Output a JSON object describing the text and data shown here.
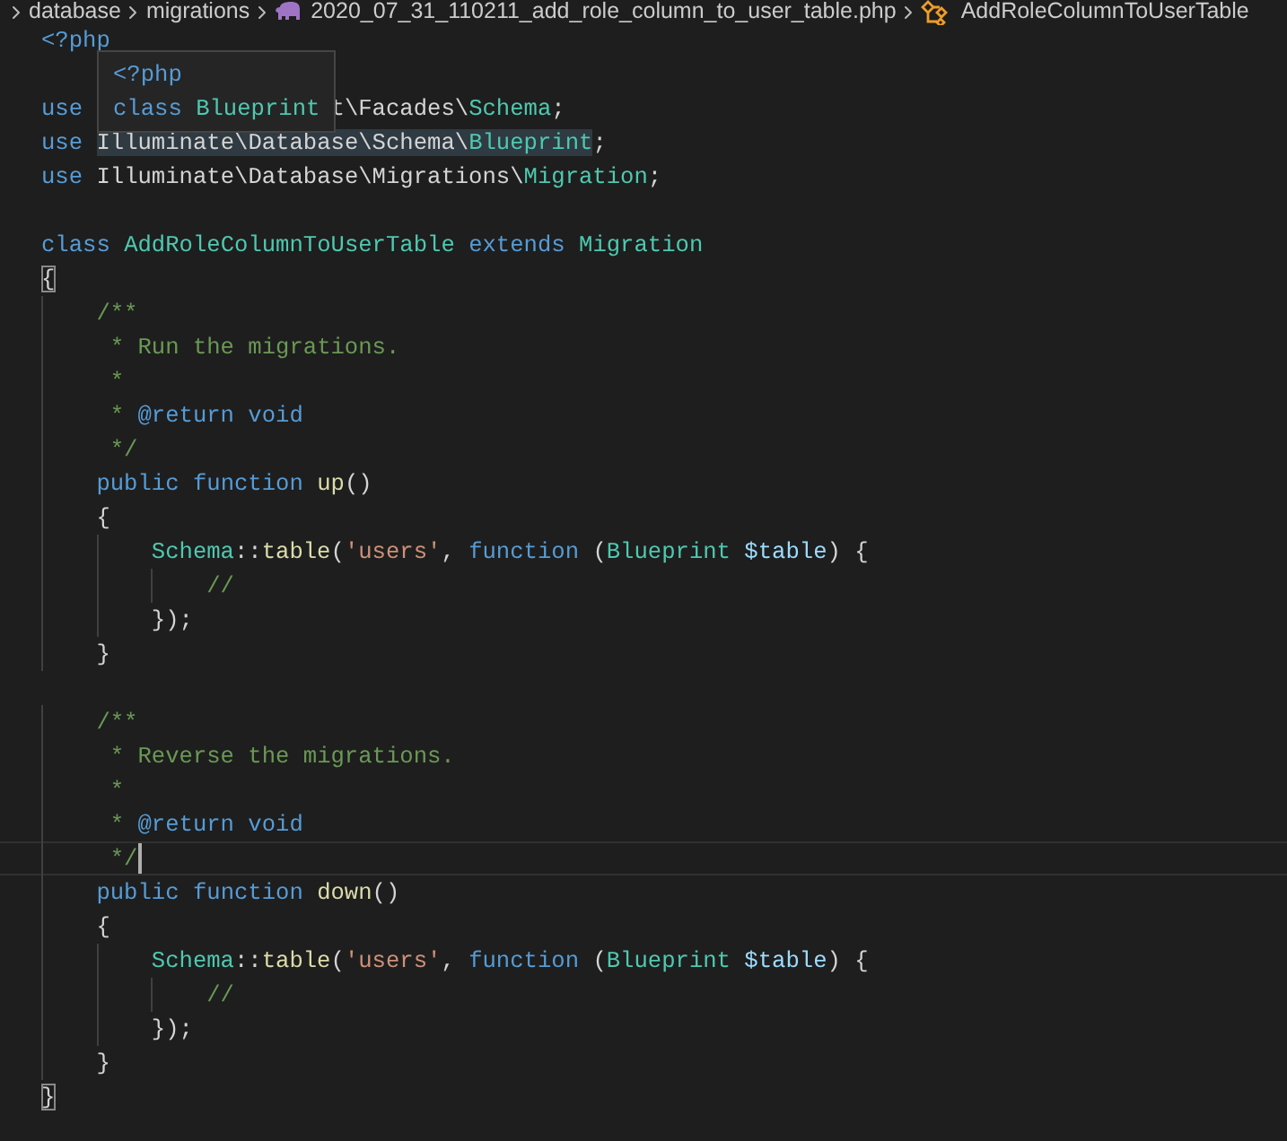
{
  "breadcrumb": [
    {
      "text": "database",
      "kind": "folder"
    },
    {
      "text": "migrations",
      "kind": "folder"
    },
    {
      "text": "2020_07_31_110211_add_role_column_to_user_table.php",
      "kind": "file"
    },
    {
      "text": "AddRoleColumnToUserTable",
      "kind": "symbol"
    }
  ],
  "tooltip": {
    "lines": [
      [
        {
          "text": "<?php",
          "kind": "keyword"
        }
      ],
      [
        {
          "text": "class ",
          "kind": "keyword"
        },
        {
          "text": "Blueprint",
          "kind": "type"
        }
      ]
    ]
  },
  "lines": [
    {
      "tokens": [
        {
          "text": "<?php",
          "kind": "keyword"
        }
      ]
    },
    {
      "kind": "blank"
    },
    {
      "tokens": [
        {
          "text": "use ",
          "kind": "keyword"
        }
      ],
      "after_tooltip": [
        {
          "text": "t\\Facades\\",
          "kind": "plain"
        },
        {
          "text": "Schema",
          "kind": "type"
        },
        {
          "text": ";",
          "kind": "plain"
        }
      ]
    },
    {
      "tokens": [
        {
          "text": "use ",
          "kind": "keyword"
        },
        {
          "text": "Illuminate\\Database\\Schema\\",
          "kind": "plain",
          "highlighted": true
        },
        {
          "text": "Blueprint",
          "kind": "type",
          "highlighted": true
        },
        {
          "text": ";",
          "kind": "plain"
        }
      ]
    },
    {
      "tokens": [
        {
          "text": "use ",
          "kind": "keyword"
        },
        {
          "text": "Illuminate\\Database\\Migrations\\",
          "kind": "plain"
        },
        {
          "text": "Migration",
          "kind": "type"
        },
        {
          "text": ";",
          "kind": "plain"
        }
      ]
    },
    {
      "kind": "blank"
    },
    {
      "tokens": [
        {
          "text": "class ",
          "kind": "keyword"
        },
        {
          "text": "AddRoleColumnToUserTable",
          "kind": "type"
        },
        {
          "text": " extends ",
          "kind": "keyword"
        },
        {
          "text": "Migration",
          "kind": "type"
        }
      ]
    },
    {
      "tokens": [
        {
          "text": "{",
          "kind": "plain",
          "matched": true
        }
      ]
    },
    {
      "tokens": [
        {
          "text": "    /**",
          "kind": "comment"
        }
      ]
    },
    {
      "tokens": [
        {
          "text": "     * Run the migrations.",
          "kind": "comment"
        }
      ]
    },
    {
      "tokens": [
        {
          "text": "     *",
          "kind": "comment"
        }
      ]
    },
    {
      "tokens": [
        {
          "text": "     * ",
          "kind": "comment"
        },
        {
          "text": "@return void",
          "kind": "keyword"
        }
      ]
    },
    {
      "tokens": [
        {
          "text": "     */",
          "kind": "comment"
        }
      ]
    },
    {
      "tokens": [
        {
          "text": "    public function ",
          "kind": "keyword"
        },
        {
          "text": "up",
          "kind": "function"
        },
        {
          "text": "()",
          "kind": "plain"
        }
      ]
    },
    {
      "tokens": [
        {
          "text": "    {",
          "kind": "plain"
        }
      ]
    },
    {
      "tokens": [
        {
          "text": "        Schema",
          "kind": "type"
        },
        {
          "text": "::",
          "kind": "plain"
        },
        {
          "text": "table",
          "kind": "function"
        },
        {
          "text": "(",
          "kind": "plain"
        },
        {
          "text": "'users'",
          "kind": "string"
        },
        {
          "text": ", ",
          "kind": "plain"
        },
        {
          "text": "function ",
          "kind": "keyword"
        },
        {
          "text": "(",
          "kind": "plain"
        },
        {
          "text": "Blueprint ",
          "kind": "type"
        },
        {
          "text": "$table",
          "kind": "variable"
        },
        {
          "text": ") {",
          "kind": "plain"
        }
      ]
    },
    {
      "tokens": [
        {
          "text": "            //",
          "kind": "comment"
        }
      ]
    },
    {
      "tokens": [
        {
          "text": "        });",
          "kind": "plain"
        }
      ]
    },
    {
      "tokens": [
        {
          "text": "    }",
          "kind": "plain"
        }
      ]
    },
    {
      "kind": "blank"
    },
    {
      "tokens": [
        {
          "text": "    /**",
          "kind": "comment"
        }
      ]
    },
    {
      "tokens": [
        {
          "text": "     * Reverse the migrations.",
          "kind": "comment"
        }
      ]
    },
    {
      "tokens": [
        {
          "text": "     *",
          "kind": "comment"
        }
      ]
    },
    {
      "tokens": [
        {
          "text": "     * ",
          "kind": "comment"
        },
        {
          "text": "@return void",
          "kind": "keyword"
        }
      ]
    },
    {
      "tokens": [
        {
          "text": "     */",
          "kind": "comment"
        }
      ],
      "current": true
    },
    {
      "tokens": [
        {
          "text": "    public function ",
          "kind": "keyword"
        },
        {
          "text": "down",
          "kind": "function"
        },
        {
          "text": "()",
          "kind": "plain"
        }
      ]
    },
    {
      "tokens": [
        {
          "text": "    {",
          "kind": "plain"
        }
      ]
    },
    {
      "tokens": [
        {
          "text": "        Schema",
          "kind": "type"
        },
        {
          "text": "::",
          "kind": "plain"
        },
        {
          "text": "table",
          "kind": "function"
        },
        {
          "text": "(",
          "kind": "plain"
        },
        {
          "text": "'users'",
          "kind": "string"
        },
        {
          "text": ", ",
          "kind": "plain"
        },
        {
          "text": "function ",
          "kind": "keyword"
        },
        {
          "text": "(",
          "kind": "plain"
        },
        {
          "text": "Blueprint ",
          "kind": "type"
        },
        {
          "text": "$table",
          "kind": "variable"
        },
        {
          "text": ") {",
          "kind": "plain"
        }
      ]
    },
    {
      "tokens": [
        {
          "text": "            //",
          "kind": "comment"
        }
      ]
    },
    {
      "tokens": [
        {
          "text": "        });",
          "kind": "plain"
        }
      ]
    },
    {
      "tokens": [
        {
          "text": "    }",
          "kind": "plain"
        }
      ]
    },
    {
      "tokens": [
        {
          "text": "}",
          "kind": "plain",
          "matched": true
        }
      ]
    }
  ]
}
